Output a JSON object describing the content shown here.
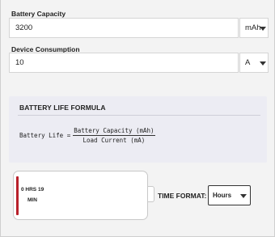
{
  "capacity": {
    "label": "Battery Capacity",
    "value": "3200",
    "unit": "mAh"
  },
  "consumption": {
    "label": "Device Consumption",
    "value": "10",
    "unit": "A"
  },
  "formula": {
    "title": "BATTERY LIFE FORMULA",
    "lhs": "Battery Life =",
    "numerator": "Battery Capacity (mAh)",
    "denominator": "Load Current (mA)"
  },
  "battery": {
    "charge_fraction": 0.02,
    "line1": "0 HRS 19",
    "line2": "MIN",
    "charge_color": "#b8202a"
  },
  "time_format": {
    "label": "TIME FORMAT:",
    "selected": "Hours"
  }
}
